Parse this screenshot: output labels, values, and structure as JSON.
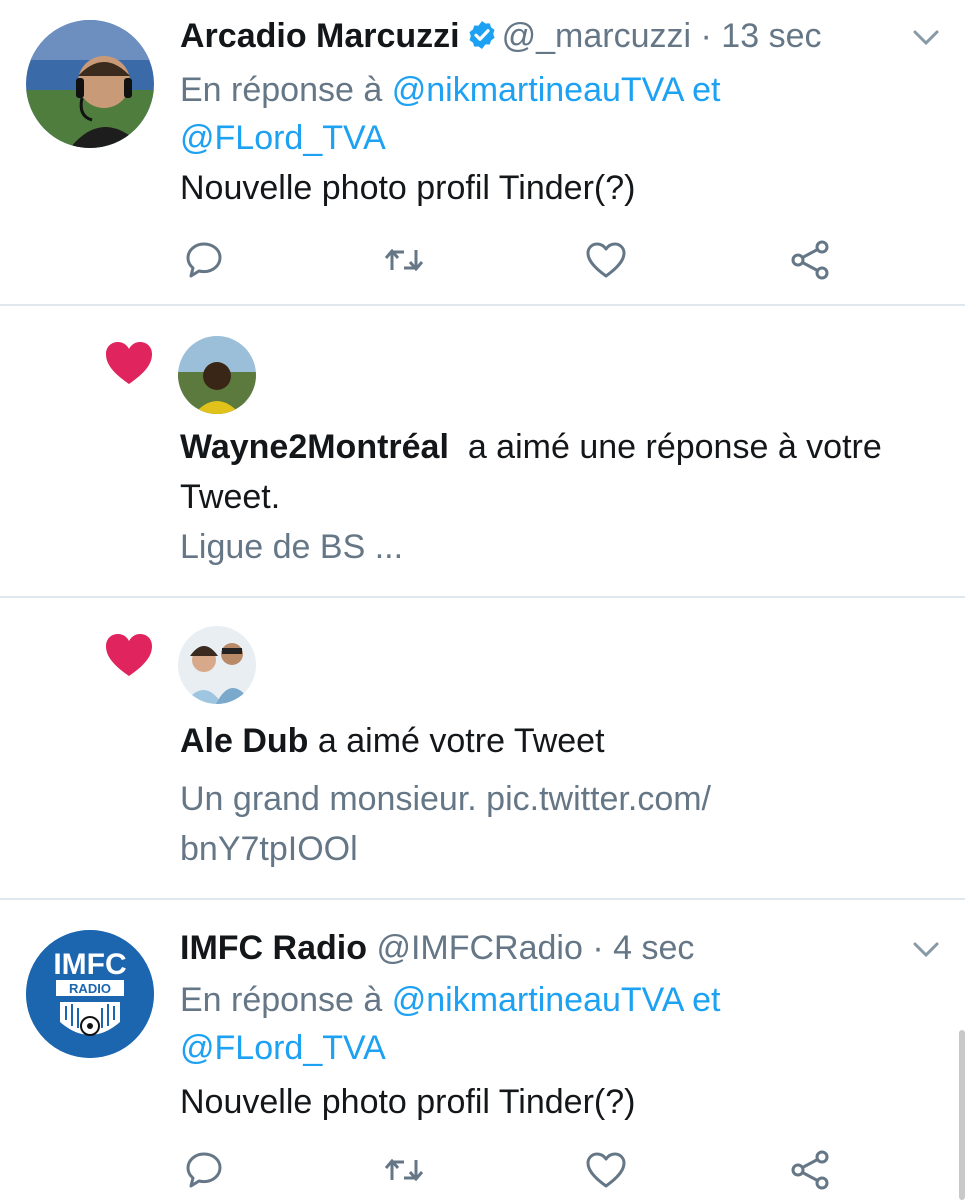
{
  "tweets": [
    {
      "name": "Arcadio Marcuzzi",
      "handle": "@_marcuzzi",
      "time": "· 13 sec",
      "reply_prefix": "En réponse à",
      "reply_user1": "@nikmartineauTVA",
      "reply_and": "et",
      "reply_user2": "@FLord_TVA",
      "text": "Nouvelle photo profil Tinder(?)",
      "verified": true
    },
    {
      "name": "IMFC Radio",
      "handle": "@IMFCRadio",
      "time": "· 4 sec",
      "reply_prefix": "En réponse à",
      "reply_user1": "@nikmartineauTVA",
      "reply_and": "et",
      "reply_user2": "@FLord_TVA",
      "text": "Nouvelle photo profil Tinder(?)",
      "verified": false,
      "logo_text": "IMFC",
      "logo_subtext": "RADIO"
    }
  ],
  "notifications": [
    {
      "user": "Wayne2Montréal",
      "action": "a aimé une réponse à votre",
      "action_cont": "Tweet.",
      "preview": "Ligue de BS ..."
    },
    {
      "user": "Ale Dub",
      "action": "a aimé votre Tweet",
      "preview_line1": "Un grand monsieur. pic.twitter.com/",
      "preview_line2": "bnY7tpIOOl"
    }
  ],
  "colors": {
    "link": "#1da1f2",
    "muted": "#657786",
    "heart": "#e0245e",
    "divider": "#e1e8ed"
  },
  "icons": [
    "reply-icon",
    "retweet-icon",
    "like-icon",
    "share-icon",
    "chevron-down-icon",
    "verified-icon",
    "heart-icon"
  ]
}
